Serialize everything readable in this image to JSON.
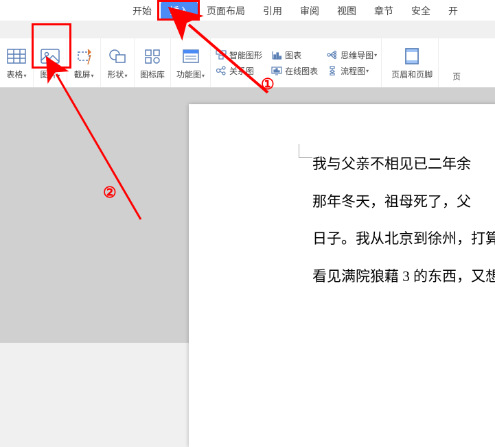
{
  "quickAccess": {
    "items": [
      "print-icon",
      "save-icon",
      "preview-icon",
      "undo-icon",
      "redo-icon"
    ]
  },
  "tabs": {
    "beginTrunc": "开",
    "start": "开始",
    "insert": "插入",
    "pageLayout": "页面布局",
    "reference": "引用",
    "review": "审阅",
    "view": "视图",
    "chapter": "章节",
    "security": "安全",
    "endTrunc": "开"
  },
  "ribbon": {
    "table": "表格",
    "picture": "图片",
    "screenshot": "截屏",
    "shape": "形状",
    "iconLib": "图标库",
    "funcChart": "功能图",
    "smartArt": "智能图形",
    "chart": "图表",
    "relation": "关系图",
    "onlineChart": "在线图表",
    "mindMap": "思维导图",
    "flowChart": "流程图",
    "headerFooter": "页眉和页脚",
    "pageTrunc": "页"
  },
  "annotations": {
    "num1": "①",
    "num2": "②"
  },
  "document": {
    "p1": "我与父亲不相见已二年余",
    "p2": "那年冬天，祖母死了，父",
    "p3": "日子。我从北京到徐州，打算",
    "p4": "看见满院狼藉 3 的东西，又想"
  }
}
